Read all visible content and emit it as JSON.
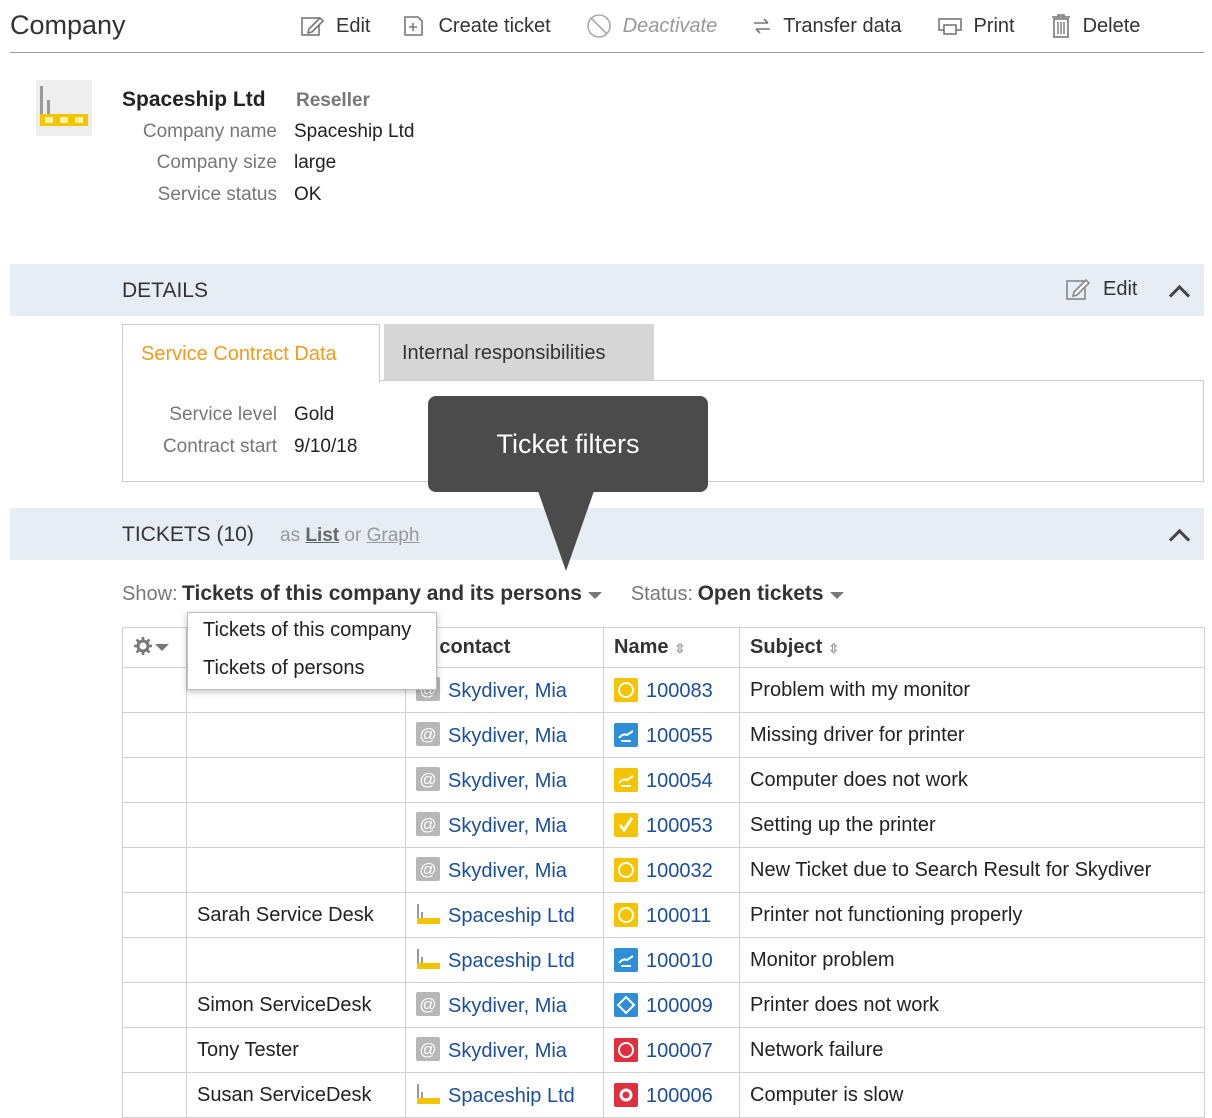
{
  "header": {
    "title": "Company",
    "toolbar": [
      {
        "label": "Edit",
        "icon": "edit-icon",
        "disabled": false
      },
      {
        "label": "Create ticket",
        "icon": "create-ticket-icon",
        "disabled": false
      },
      {
        "label": "Deactivate",
        "icon": "deactivate-icon",
        "disabled": true
      },
      {
        "label": "Transfer data",
        "icon": "transfer-icon",
        "disabled": false
      },
      {
        "label": "Print",
        "icon": "print-icon",
        "disabled": false
      },
      {
        "label": "Delete",
        "icon": "delete-icon",
        "disabled": false
      }
    ]
  },
  "company": {
    "name": "Spaceship Ltd",
    "type": "Reseller",
    "fields": [
      {
        "label": "Company name",
        "value": "Spaceship Ltd"
      },
      {
        "label": "Company size",
        "value": "large"
      },
      {
        "label": "Service status",
        "value": "OK"
      }
    ]
  },
  "details": {
    "title": "DETAILS",
    "edit_label": "Edit",
    "tabs": [
      "Service Contract Data",
      "Internal responsibilities"
    ],
    "active_tab": 0,
    "fields": [
      {
        "label": "Service level",
        "value": "Gold"
      },
      {
        "label": "Contract start",
        "value": "9/10/18"
      }
    ]
  },
  "tooltip": {
    "text": "Ticket filters"
  },
  "tickets": {
    "title": "TICKETS (10)",
    "view_prefix": "as",
    "view_list": "List",
    "view_or": "or",
    "view_graph": "Graph",
    "show_label": "Show:",
    "show_value": "Tickets of this company and its persons",
    "status_label": "Status:",
    "status_value": "Open tickets",
    "dropdown_options": [
      "Tickets of this company",
      "Tickets of persons"
    ],
    "columns": [
      "",
      "",
      "in contact",
      "Name",
      "Subject"
    ],
    "rows": [
      {
        "resp": "",
        "contact": "Skydiver, Mia",
        "contact_icon": "person",
        "name": "100083",
        "icon_color": "#f5c400",
        "icon": "circle",
        "subject": "Problem with my monitor"
      },
      {
        "resp": "",
        "contact": "Skydiver, Mia",
        "contact_icon": "person",
        "name": "100055",
        "icon_color": "#2e8fd6",
        "icon": "hand",
        "subject": "Missing driver for printer"
      },
      {
        "resp": "",
        "contact": "Skydiver, Mia",
        "contact_icon": "person",
        "name": "100054",
        "icon_color": "#f5c400",
        "icon": "hand",
        "subject": "Computer does not work"
      },
      {
        "resp": "",
        "contact": "Skydiver, Mia",
        "contact_icon": "person",
        "name": "100053",
        "icon_color": "#f5c400",
        "icon": "check",
        "subject": "Setting up the printer"
      },
      {
        "resp": "",
        "contact": "Skydiver, Mia",
        "contact_icon": "person",
        "name": "100032",
        "icon_color": "#f5c400",
        "icon": "circle",
        "subject": "New Ticket due to Search Result for Skydiver"
      },
      {
        "resp": "Sarah Service Desk",
        "contact": "Spaceship Ltd",
        "contact_icon": "company",
        "name": "100011",
        "icon_color": "#f5c400",
        "icon": "circle",
        "subject": "Printer not functioning properly"
      },
      {
        "resp": "",
        "contact": "Spaceship Ltd",
        "contact_icon": "company",
        "name": "100010",
        "icon_color": "#2e8fd6",
        "icon": "hand",
        "subject": "Monitor problem"
      },
      {
        "resp": "Simon ServiceDesk",
        "contact": "Skydiver, Mia",
        "contact_icon": "person",
        "name": "100009",
        "icon_color": "#2e8fd6",
        "icon": "diamond",
        "subject": "Printer does not work"
      },
      {
        "resp": "Tony Tester",
        "contact": "Skydiver, Mia",
        "contact_icon": "person",
        "name": "100007",
        "icon_color": "#e03040",
        "icon": "circle",
        "subject": "Network failure"
      },
      {
        "resp": "Susan ServiceDesk",
        "contact": "Spaceship Ltd",
        "contact_icon": "company",
        "name": "100006",
        "icon_color": "#e03040",
        "icon": "gear",
        "subject": "Computer is slow"
      }
    ]
  },
  "colors": {
    "accent_orange": "#f39a1b",
    "link_blue": "#1a4fa0",
    "section_bg": "#e7edf5",
    "tooltip_bg": "#4b4b4b"
  }
}
